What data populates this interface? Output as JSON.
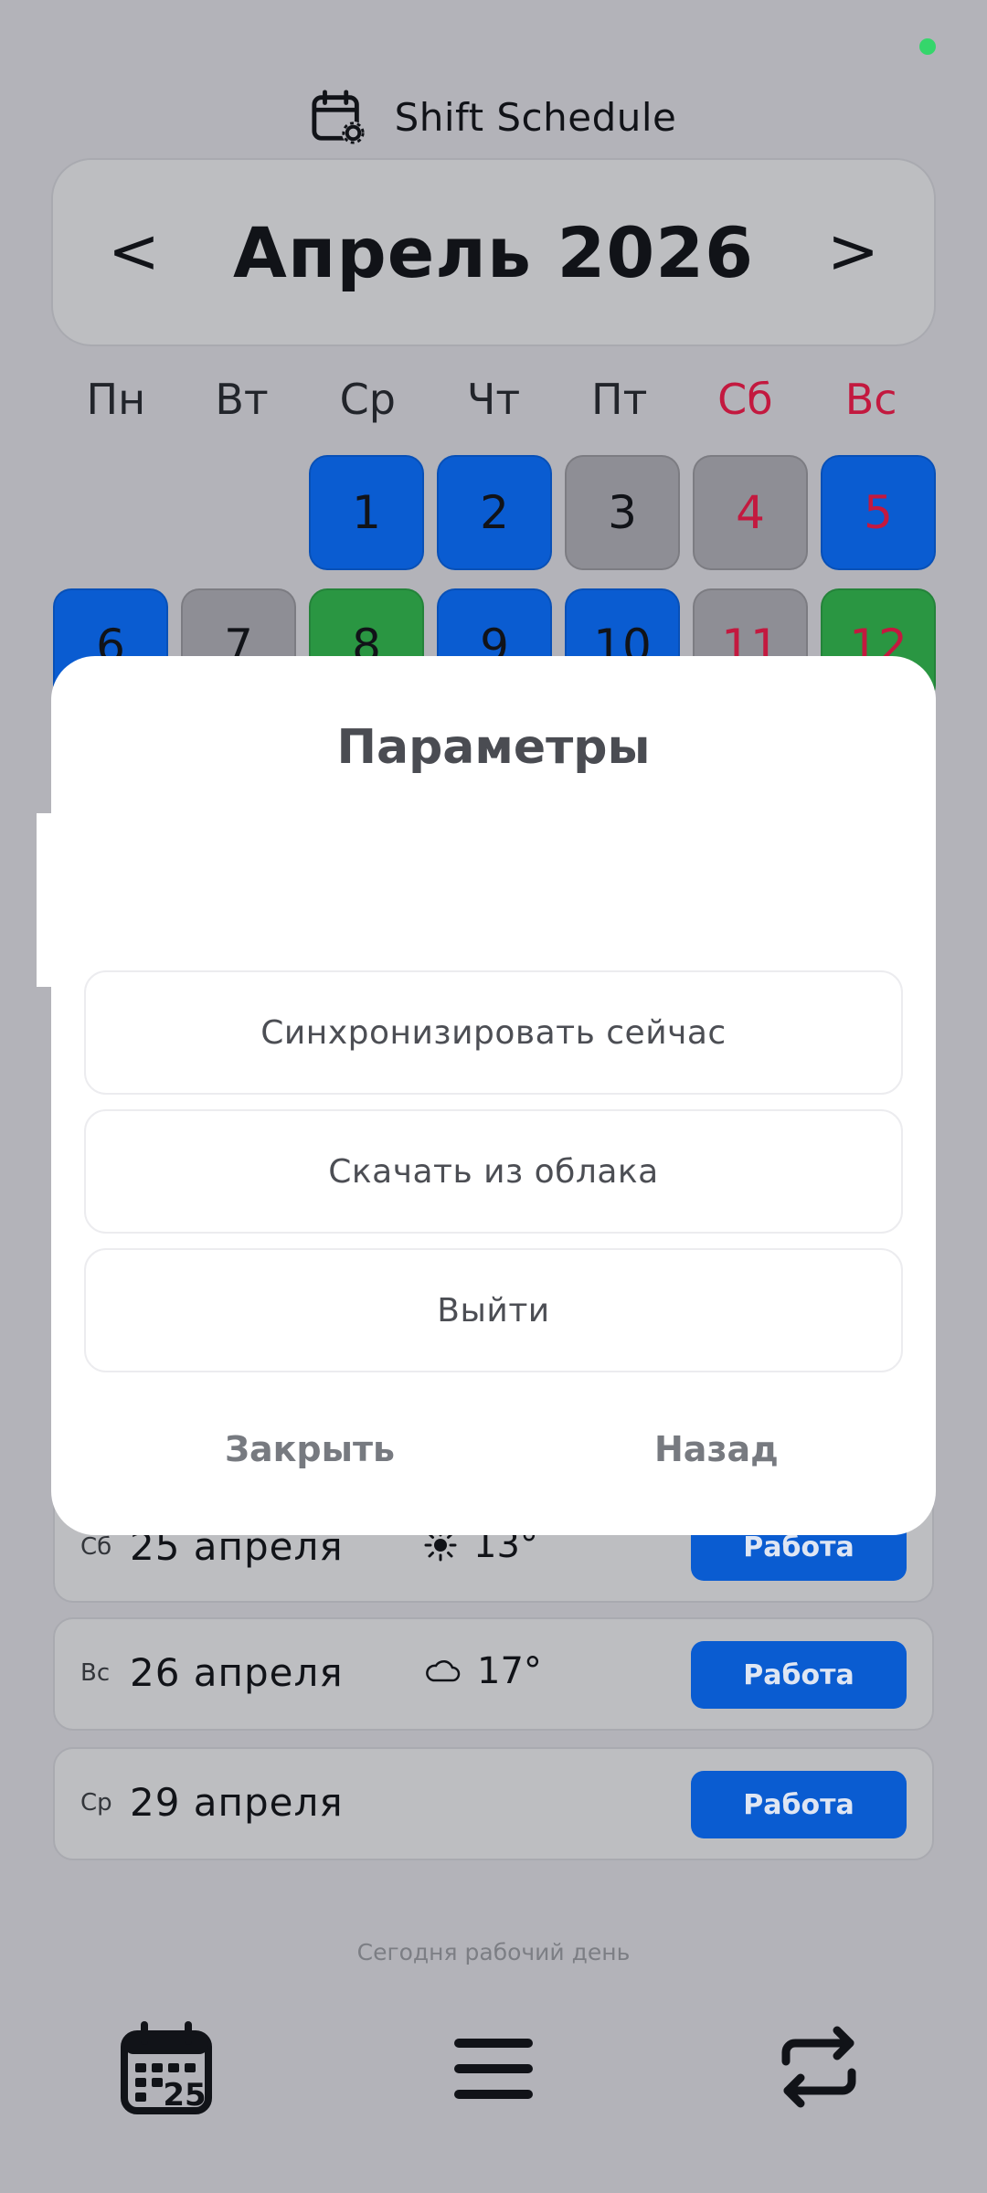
{
  "app": {
    "title": "Shift Schedule"
  },
  "month_nav": {
    "prev": "<",
    "label": "Апрель 2026",
    "next": ">"
  },
  "weekdays": [
    "Пн",
    "Вт",
    "Ср",
    "Чт",
    "Пт",
    "Сб",
    "Вс"
  ],
  "calendar": {
    "row1": [
      "1",
      "2",
      "3",
      "4",
      "5"
    ],
    "row2": [
      "6",
      "7",
      "8",
      "9",
      "10",
      "11",
      "12"
    ]
  },
  "modal": {
    "title": "Параметры",
    "buttons": [
      "Синхронизировать сейчас",
      "Скачать из облака",
      "Выйти"
    ],
    "close": "Закрыть",
    "back": "Назад"
  },
  "list": [
    {
      "dow": "Сб",
      "date": "25 апреля",
      "weather_icon": "sun-icon",
      "temp": "13°",
      "status": "Работа"
    },
    {
      "dow": "Вс",
      "date": "26 апреля",
      "weather_icon": "cloud-icon",
      "temp": "17°",
      "status": "Работа"
    },
    {
      "dow": "Ср",
      "date": "29 апреля",
      "status": "Работа"
    }
  ],
  "footer": {
    "today": "Сегодня рабочий день",
    "calendar_badge": "25"
  },
  "colors": {
    "work_blue": "#0a5cd1",
    "off_gray": "#8e8e95",
    "green": "#2a9642",
    "weekend_red": "#c3193f",
    "status_green": "#35d66b"
  }
}
